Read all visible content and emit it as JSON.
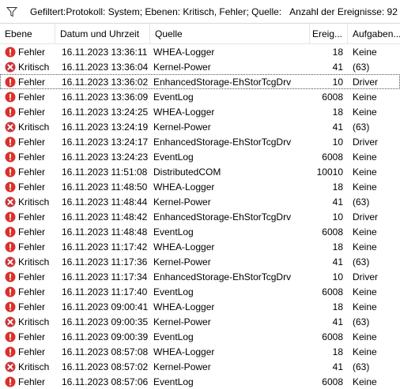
{
  "filter": {
    "icon": "filter-funnel-icon",
    "text": "Gefiltert:Protokoll: System; Ebenen: Kritisch, Fehler; Quelle:",
    "count_text": "Anzahl der Ereignisse: 92"
  },
  "columns": {
    "level": "Ebene",
    "date": "Datum und Uhrzeit",
    "source": "Quelle",
    "id": "Ereig...",
    "task": "Aufgaben..."
  },
  "colors": {
    "error": "#d9312b",
    "critical": "#c93637"
  },
  "rows": [
    {
      "level": "Fehler",
      "type": "error",
      "date": "16.11.2023 13:36:11",
      "source": "WHEA-Logger",
      "id": "18",
      "task": "Keine"
    },
    {
      "level": "Kritisch",
      "type": "critical",
      "date": "16.11.2023 13:36:04",
      "source": "Kernel-Power",
      "id": "41",
      "task": "(63)"
    },
    {
      "level": "Fehler",
      "type": "error",
      "date": "16.11.2023 13:36:02",
      "source": "EnhancedStorage-EhStorTcgDrv",
      "id": "10",
      "task": "Driver",
      "focused": true
    },
    {
      "level": "Fehler",
      "type": "error",
      "date": "16.11.2023 13:36:09",
      "source": "EventLog",
      "id": "6008",
      "task": "Keine"
    },
    {
      "level": "Fehler",
      "type": "error",
      "date": "16.11.2023 13:24:25",
      "source": "WHEA-Logger",
      "id": "18",
      "task": "Keine"
    },
    {
      "level": "Kritisch",
      "type": "critical",
      "date": "16.11.2023 13:24:19",
      "source": "Kernel-Power",
      "id": "41",
      "task": "(63)"
    },
    {
      "level": "Fehler",
      "type": "error",
      "date": "16.11.2023 13:24:17",
      "source": "EnhancedStorage-EhStorTcgDrv",
      "id": "10",
      "task": "Driver"
    },
    {
      "level": "Fehler",
      "type": "error",
      "date": "16.11.2023 13:24:23",
      "source": "EventLog",
      "id": "6008",
      "task": "Keine"
    },
    {
      "level": "Fehler",
      "type": "error",
      "date": "16.11.2023 11:51:08",
      "source": "DistributedCOM",
      "id": "10010",
      "task": "Keine"
    },
    {
      "level": "Fehler",
      "type": "error",
      "date": "16.11.2023 11:48:50",
      "source": "WHEA-Logger",
      "id": "18",
      "task": "Keine"
    },
    {
      "level": "Kritisch",
      "type": "critical",
      "date": "16.11.2023 11:48:44",
      "source": "Kernel-Power",
      "id": "41",
      "task": "(63)"
    },
    {
      "level": "Fehler",
      "type": "error",
      "date": "16.11.2023 11:48:42",
      "source": "EnhancedStorage-EhStorTcgDrv",
      "id": "10",
      "task": "Driver"
    },
    {
      "level": "Fehler",
      "type": "error",
      "date": "16.11.2023 11:48:48",
      "source": "EventLog",
      "id": "6008",
      "task": "Keine"
    },
    {
      "level": "Fehler",
      "type": "error",
      "date": "16.11.2023 11:17:42",
      "source": "WHEA-Logger",
      "id": "18",
      "task": "Keine"
    },
    {
      "level": "Kritisch",
      "type": "critical",
      "date": "16.11.2023 11:17:36",
      "source": "Kernel-Power",
      "id": "41",
      "task": "(63)"
    },
    {
      "level": "Fehler",
      "type": "error",
      "date": "16.11.2023 11:17:34",
      "source": "EnhancedStorage-EhStorTcgDrv",
      "id": "10",
      "task": "Driver"
    },
    {
      "level": "Fehler",
      "type": "error",
      "date": "16.11.2023 11:17:40",
      "source": "EventLog",
      "id": "6008",
      "task": "Keine"
    },
    {
      "level": "Fehler",
      "type": "error",
      "date": "16.11.2023 09:00:41",
      "source": "WHEA-Logger",
      "id": "18",
      "task": "Keine"
    },
    {
      "level": "Kritisch",
      "type": "critical",
      "date": "16.11.2023 09:00:35",
      "source": "Kernel-Power",
      "id": "41",
      "task": "(63)"
    },
    {
      "level": "Fehler",
      "type": "error",
      "date": "16.11.2023 09:00:39",
      "source": "EventLog",
      "id": "6008",
      "task": "Keine"
    },
    {
      "level": "Fehler",
      "type": "error",
      "date": "16.11.2023 08:57:08",
      "source": "WHEA-Logger",
      "id": "18",
      "task": "Keine"
    },
    {
      "level": "Kritisch",
      "type": "critical",
      "date": "16.11.2023 08:57:02",
      "source": "Kernel-Power",
      "id": "41",
      "task": "(63)"
    },
    {
      "level": "Fehler",
      "type": "error",
      "date": "16.11.2023 08:57:06",
      "source": "EventLog",
      "id": "6008",
      "task": "Keine"
    }
  ]
}
